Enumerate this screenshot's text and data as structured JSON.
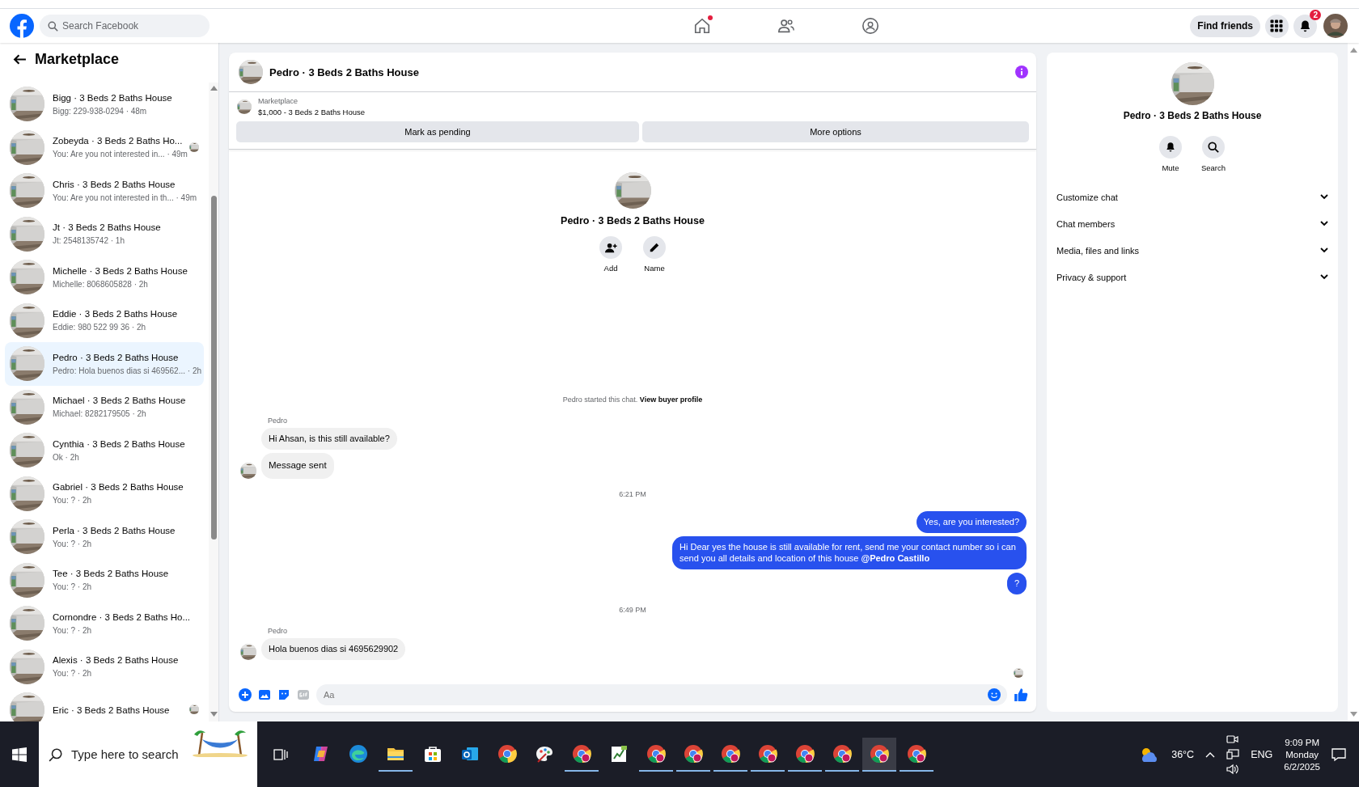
{
  "header": {
    "search": {
      "placeholder": "Search Facebook"
    },
    "nav": [
      {
        "kind": "home",
        "dot": true
      },
      {
        "kind": "friends",
        "dot": false
      },
      {
        "kind": "groups",
        "dot": false
      }
    ],
    "find_friends": "Find friends",
    "notification_count": "2"
  },
  "sidebar": {
    "title": "Marketplace",
    "conversations": [
      {
        "title": "Bigg · 3 Beds 2 Baths House",
        "preview": "Bigg: 229-938-0294 · 48m",
        "selected": false,
        "seen": false
      },
      {
        "title": "Zobeyda · 3 Beds 2 Baths Ho...",
        "preview": "You: Are you not interested in... · 49m",
        "selected": false,
        "seen": true
      },
      {
        "title": "Chris · 3 Beds 2 Baths House",
        "preview": "You: Are you not interested in th... · 49m",
        "selected": false,
        "seen": false
      },
      {
        "title": "Jt · 3 Beds 2 Baths House",
        "preview": "Jt: 2548135742 · 1h",
        "selected": false,
        "seen": false
      },
      {
        "title": "Michelle · 3 Beds 2 Baths House",
        "preview": "Michelle: 8068605828 · 2h",
        "selected": false,
        "seen": false
      },
      {
        "title": "Eddie · 3 Beds 2 Baths House",
        "preview": "Eddie: 980 522 99 36 · 2h",
        "selected": false,
        "seen": false
      },
      {
        "title": "Pedro · 3 Beds 2 Baths House",
        "preview": "Pedro: Hola buenos dias si 469562... · 2h",
        "selected": true,
        "seen": false
      },
      {
        "title": "Michael · 3 Beds 2 Baths House",
        "preview": "Michael: 8282179505 · 2h",
        "selected": false,
        "seen": false
      },
      {
        "title": "Cynthia · 3 Beds 2 Baths House",
        "preview": "Ok · 2h",
        "selected": false,
        "seen": false
      },
      {
        "title": "Gabriel · 3 Beds 2 Baths House",
        "preview": "You: ? · 2h",
        "selected": false,
        "seen": false
      },
      {
        "title": "Perla · 3 Beds 2 Baths House",
        "preview": "You: ? · 2h",
        "selected": false,
        "seen": false
      },
      {
        "title": "Tee · 3 Beds 2 Baths House",
        "preview": "You: ? · 2h",
        "selected": false,
        "seen": false
      },
      {
        "title": "Cornondre · 3 Beds 2 Baths Ho...",
        "preview": "You: ? · 2h",
        "selected": false,
        "seen": false
      },
      {
        "title": "Alexis · 3 Beds 2 Baths House",
        "preview": "You: ? · 2h",
        "selected": false,
        "seen": false
      },
      {
        "title": "Eric · 3 Beds 2 Baths House",
        "selected": false,
        "seen": true
      }
    ]
  },
  "chat": {
    "title": "Pedro · 3 Beds 2 Baths House",
    "listing": {
      "label": "Marketplace",
      "price_title": "$1,000 - 3 Beds 2 Baths House"
    },
    "buttons": [
      "Mark as pending",
      "More options"
    ],
    "intro": {
      "name": "Pedro · 3 Beds 2 Baths House",
      "actions": [
        {
          "kind": "add",
          "label": "Add"
        },
        {
          "kind": "name",
          "label": "Name"
        }
      ]
    },
    "system_text": "Pedro started this chat.",
    "system_link": "View buyer profile",
    "timeline": [
      {
        "kind": "incoming",
        "sender": "Pedro",
        "messages": [
          "Hi Ahsan, is this still available?",
          "Message sent"
        ]
      },
      {
        "kind": "time",
        "text": "6:21 PM"
      },
      {
        "kind": "outgoing",
        "messages": [
          "Yes, are you interested?",
          "Hi Dear yes the house is still available for rent, send me your contact number so i can send you all details and location of this house **@Pedro Castillo**",
          "?"
        ]
      },
      {
        "kind": "time",
        "text": "6:49 PM"
      },
      {
        "kind": "incoming",
        "sender": "Pedro",
        "messages": [
          "Hola buenos dias si 4695629902"
        ]
      }
    ],
    "composer": {
      "placeholder": "Aa"
    }
  },
  "details": {
    "name": "Pedro · 3 Beds 2 Baths House",
    "actions": [
      {
        "kind": "mute",
        "label": "Mute"
      },
      {
        "kind": "search",
        "label": "Search"
      }
    ],
    "sections": [
      {
        "label": "Customize chat",
        "expanded": false
      },
      {
        "label": "Chat members",
        "expanded": false
      },
      {
        "label": "Media, files and links",
        "expanded": false
      },
      {
        "label": "Privacy & support",
        "expanded": false
      }
    ]
  },
  "taskbar": {
    "search": {
      "placeholder": "Type here to search"
    },
    "apps": [
      {
        "kind": "copilot",
        "running": false,
        "active": false
      },
      {
        "kind": "edge",
        "running": false,
        "active": false
      },
      {
        "kind": "explorer",
        "running": true,
        "active": false
      },
      {
        "kind": "store",
        "running": false,
        "active": false
      },
      {
        "kind": "outlook",
        "running": false,
        "active": false
      },
      {
        "kind": "chrome",
        "running": false,
        "active": false
      },
      {
        "kind": "paint",
        "running": false,
        "active": false
      },
      {
        "kind": "chrome-profile",
        "running": true,
        "active": false
      },
      {
        "kind": "sheet",
        "running": false,
        "active": false
      },
      {
        "kind": "chrome-profile",
        "running": true,
        "active": false
      },
      {
        "kind": "chrome-profile",
        "running": true,
        "active": false
      },
      {
        "kind": "chrome-profile",
        "running": true,
        "active": false
      },
      {
        "kind": "chrome-profile",
        "running": true,
        "active": false
      },
      {
        "kind": "chrome-profile",
        "running": true,
        "active": false
      },
      {
        "kind": "chrome-profile",
        "running": true,
        "active": false
      },
      {
        "kind": "chrome-profile",
        "running": true,
        "active": true
      },
      {
        "kind": "chrome-profile",
        "running": true,
        "active": false
      }
    ],
    "temperature": "36°C",
    "language": "ENG",
    "time": "9:09 PM",
    "day": "Monday",
    "date": "6/2/2025"
  }
}
